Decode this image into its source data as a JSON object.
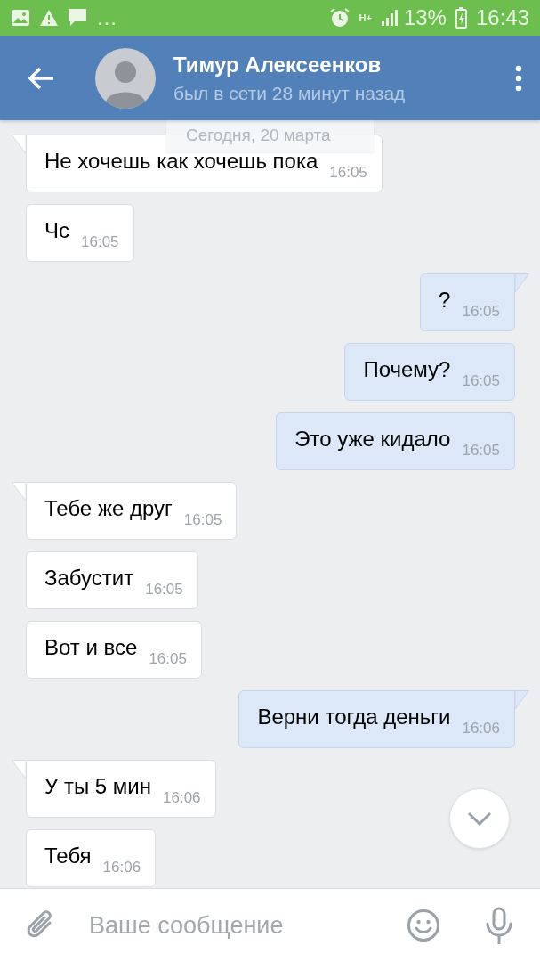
{
  "status_bar": {
    "more": "…",
    "network": "H+",
    "battery": "13%",
    "time": "16:43"
  },
  "header": {
    "name": "Тимур Алексеенков",
    "status": "был в сети 28 минут назад"
  },
  "date_divider": "Сегодня, 20 марта",
  "messages": [
    {
      "kind": "incoming",
      "tail": true,
      "text": "Не хочешь как хочешь пока",
      "time": "16:05"
    },
    {
      "kind": "incoming",
      "tail": false,
      "text": "Чс",
      "time": "16:05"
    },
    {
      "kind": "outgoing",
      "tail": true,
      "text": "?",
      "time": "16:05"
    },
    {
      "kind": "outgoing",
      "tail": false,
      "text": "Почему?",
      "time": "16:05"
    },
    {
      "kind": "outgoing",
      "tail": false,
      "text": "Это уже кидало",
      "time": "16:05"
    },
    {
      "kind": "incoming",
      "tail": true,
      "text": "Тебе же друг",
      "time": "16:05"
    },
    {
      "kind": "incoming",
      "tail": false,
      "text": "Забустит",
      "time": "16:05"
    },
    {
      "kind": "incoming",
      "tail": false,
      "text": "Вот и все",
      "time": "16:05"
    },
    {
      "kind": "outgoing",
      "tail": true,
      "text": "Верни тогда деньги",
      "time": "16:06"
    },
    {
      "kind": "incoming",
      "tail": true,
      "text": "У ты 5 мин",
      "time": "16:06"
    },
    {
      "kind": "incoming",
      "tail": false,
      "text": "Тебя",
      "time": "16:06"
    }
  ],
  "composer": {
    "placeholder": "Ваше сообщение"
  }
}
